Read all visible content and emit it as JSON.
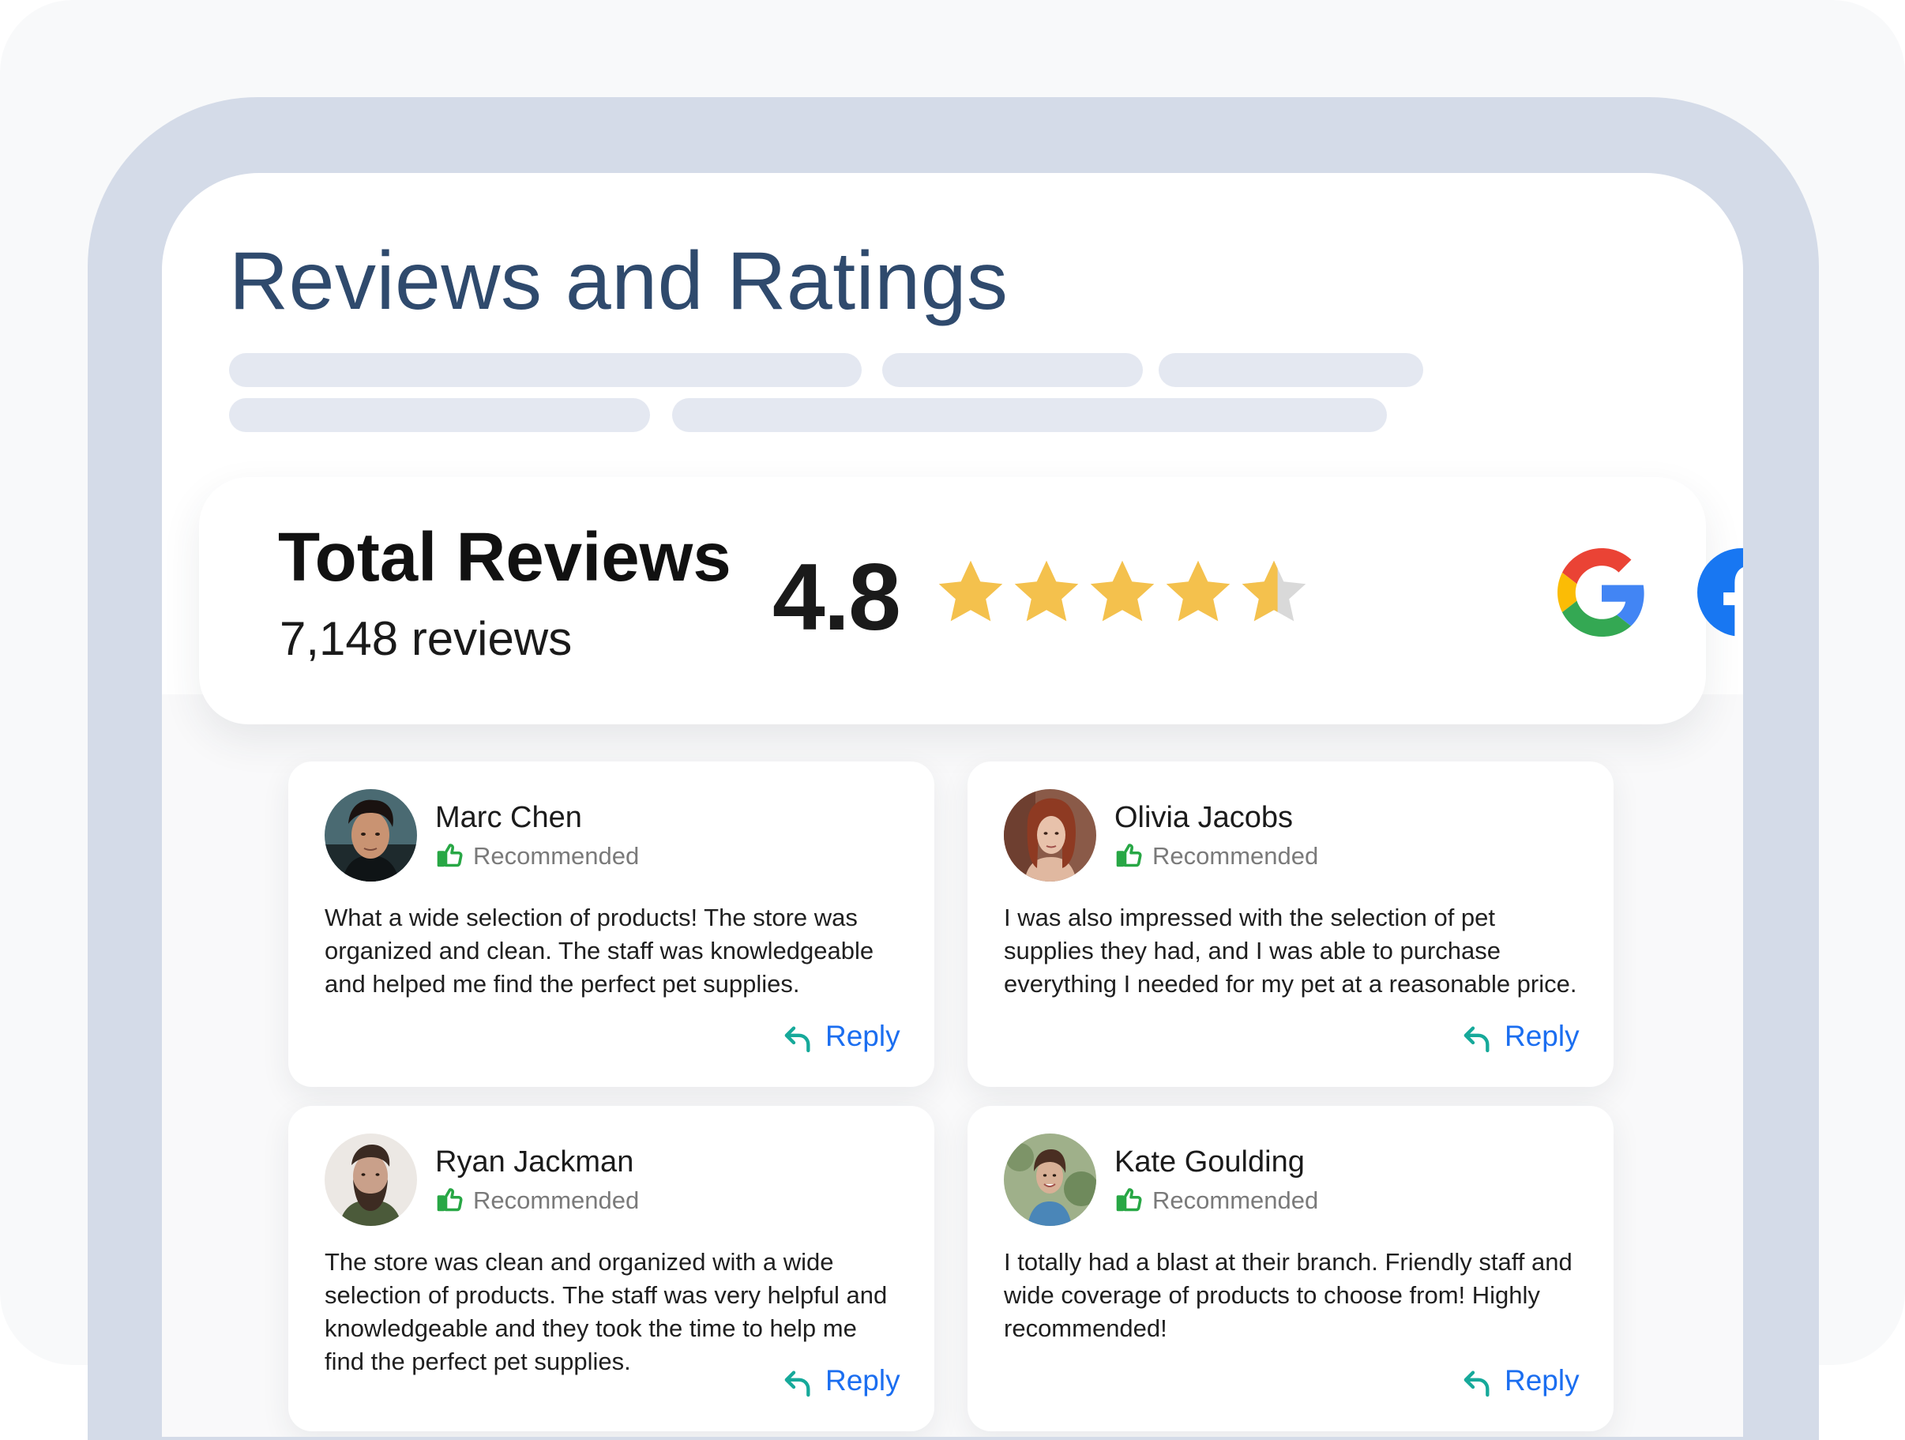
{
  "page": {
    "title": "Reviews and Ratings"
  },
  "summary": {
    "title": "Total Reviews",
    "count_text": "7,148 reviews",
    "rating": "4.8",
    "stars_filled_fraction": 0.8,
    "sources": [
      "google-icon",
      "facebook-icon"
    ]
  },
  "colors": {
    "title": "#2f4a6d",
    "star": "#f4c14d",
    "star_empty": "#d9d9d9",
    "recommended_green": "#28a745",
    "reply_blue": "#1b6ef0",
    "reply_icon_teal": "#16a99a",
    "facebook_blue": "#1877f2",
    "frame": "#d4dbe8",
    "skeleton": "#e4e8f1"
  },
  "reviews": [
    {
      "name": "Marc Chen",
      "recommended_label": "Recommended",
      "text": "What a wide selection of products! The store was organized and clean. The staff was knowledgeable and helped me find the perfect pet supplies.",
      "reply_label": "Reply"
    },
    {
      "name": "Olivia Jacobs",
      "recommended_label": "Recommended",
      "text": "I was also impressed with the selection of pet supplies they had, and I was able to purchase everything I needed for my pet at a reasonable price.",
      "reply_label": "Reply"
    },
    {
      "name": "Ryan Jackman",
      "recommended_label": "Recommended",
      "text": "The store was clean and organized with a wide selection of products. The staff was very helpful and knowledgeable and they took the time to help me find the perfect pet supplies.",
      "reply_label": "Reply"
    },
    {
      "name": "Kate Goulding",
      "recommended_label": "Recommended",
      "text": "I totally had a blast at their branch. Friendly staff and wide coverage of products to choose from! Highly recommended!",
      "reply_label": "Reply"
    }
  ]
}
